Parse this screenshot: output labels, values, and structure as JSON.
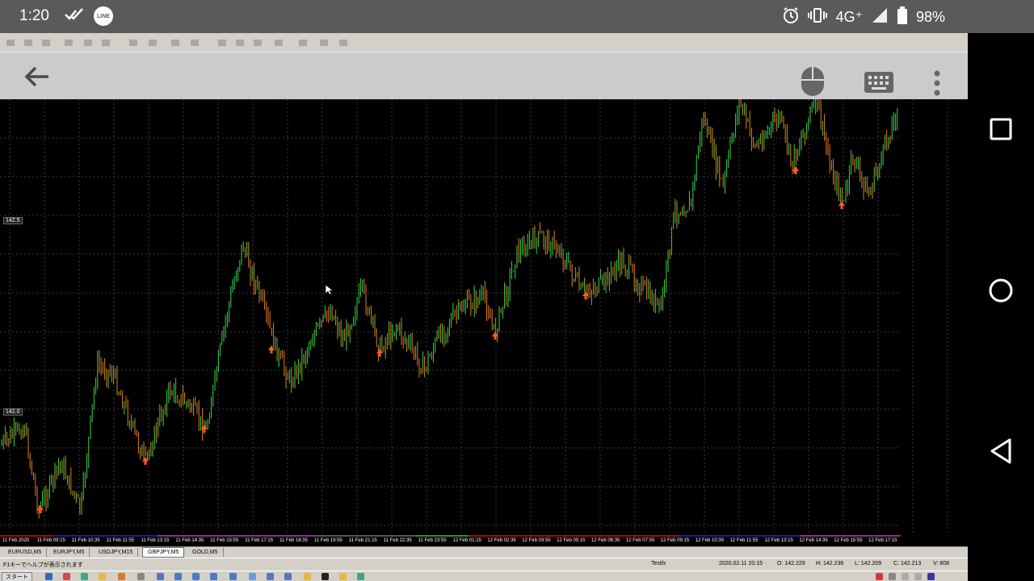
{
  "status_bar": {
    "time": "1:20",
    "line_label": "LINE",
    "network": "4G⁺",
    "battery": "98%"
  },
  "chart": {
    "price_labels": [
      "142.5",
      "142.0"
    ],
    "time_labels": [
      "11 Feb 2020",
      "11 Feb 09:15",
      "11 Feb 10:35",
      "11 Feb 11:55",
      "11 Feb 13:15",
      "11 Feb 14:35",
      "11 Feb 15:55",
      "11 Feb 17:15",
      "11 Feb 18:35",
      "11 Feb 19:55",
      "11 Feb 21:15",
      "11 Feb 22:35",
      "11 Feb 23:55",
      "12 Feb 01:15",
      "12 Feb 02:35",
      "12 Feb 03:55",
      "12 Feb 05:15",
      "12 Feb 06:35",
      "12 Feb 07:55",
      "12 Feb 09:15",
      "12 Feb 10:35",
      "12 Feb 11:55",
      "12 Feb 13:15",
      "12 Feb 14:35",
      "12 Feb 15:55",
      "12 Feb 17:15"
    ]
  },
  "tabs": [
    "EURUSD,M5",
    "EURJPY,M5",
    "USDJPY,M15",
    "GBPJPY,M5",
    "GOLD,M5"
  ],
  "active_tab": "GBPJPY,M5",
  "mt4_status": {
    "help": "F1キーでヘルプが表示されます",
    "profile": "Testfx",
    "datetime": "2020.02.11 20:15",
    "open": "O: 142.229",
    "high": "H: 142.236",
    "low": "L: 142.209",
    "close": "C: 142.213",
    "volume": "V: 808"
  },
  "taskbar": {
    "start": "スタート"
  },
  "colors": {
    "bull": "#3fd24a",
    "bear": "#e08020",
    "arrow": "#ff5a1e",
    "grid": "#3a3a3a"
  }
}
